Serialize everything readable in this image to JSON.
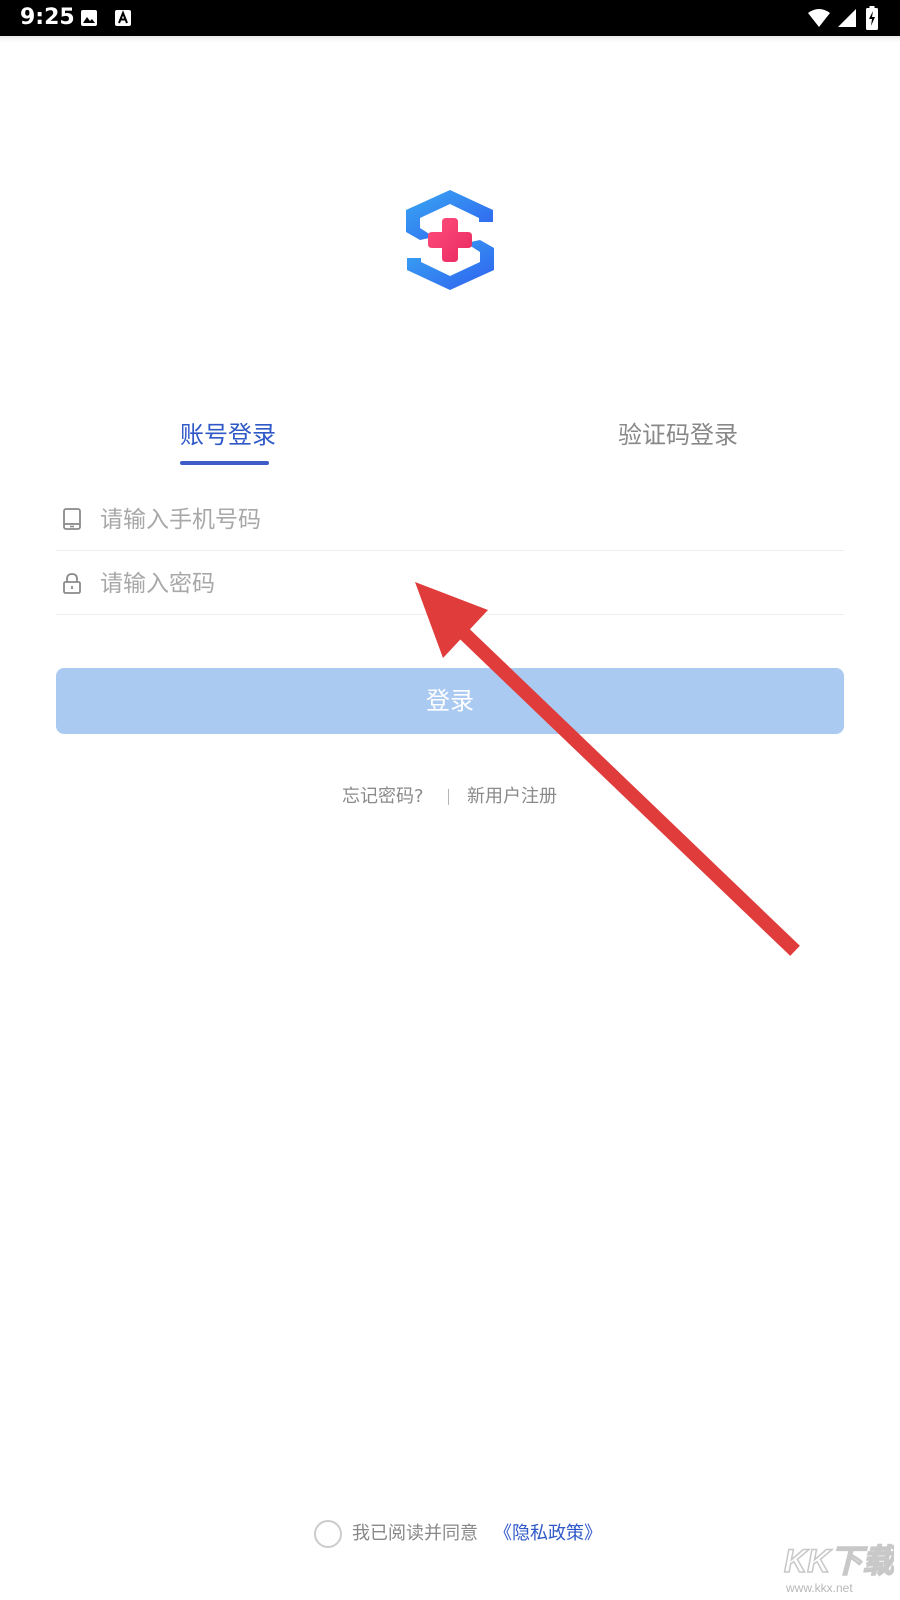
{
  "status_bar": {
    "time": "9:25",
    "icons": [
      "image-icon",
      "a-icon",
      "wifi-icon",
      "signal-icon",
      "battery-charging-icon"
    ]
  },
  "logo": {
    "icon": "medical-cross-logo-icon",
    "colors": {
      "blue": "#2f6ff0",
      "blue_light": "#39a9f2",
      "pink": "#f2336f"
    }
  },
  "tabs": [
    {
      "label": "账号登录",
      "active": true
    },
    {
      "label": "验证码登录",
      "active": false
    }
  ],
  "form": {
    "phone": {
      "value": "",
      "placeholder": "请输入手机号码",
      "icon": "phone-icon"
    },
    "password": {
      "value": "",
      "placeholder": "请输入密码",
      "icon": "lock-icon"
    }
  },
  "login_button": {
    "label": "登录"
  },
  "links": {
    "forgot": "忘记密码?",
    "register": "新用户注册"
  },
  "agreement": {
    "checked": false,
    "text": "我已阅读并同意",
    "link": "《隐私政策》"
  },
  "watermark": {
    "text": "KK下载",
    "site": "www.kkx.net"
  },
  "colors": {
    "accent": "#3059c8",
    "button_disabled": "#abcaf2",
    "placeholder": "#a8a8a8",
    "annotation_arrow": "#e03c3c"
  }
}
